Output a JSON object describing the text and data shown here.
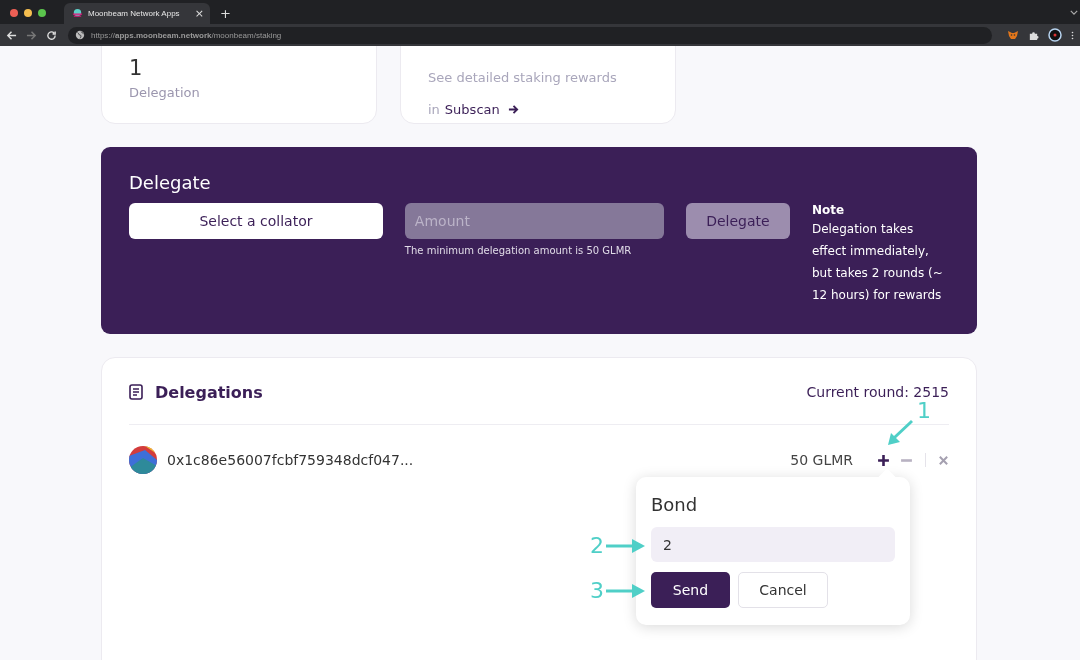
{
  "browser": {
    "tab_title": "Moonbeam Network Apps",
    "tab_close": "×",
    "new_tab": "+",
    "url": "https://**apps.moonbeam.network**/moonbeam/staking",
    "forward_disabled": true
  },
  "summary_cards": [
    {
      "kind": "stat",
      "value": "1",
      "label": "Delegation"
    },
    {
      "kind": "link",
      "text": "See detailed staking rewards",
      "prefix": "in",
      "link": "Subscan"
    }
  ],
  "delegate_panel": {
    "title": "Delegate",
    "collator_button": "Select a collator",
    "amount": {
      "placeholder": "Amount"
    },
    "hint": "The minimum delegation amount is 50 GLMR",
    "delegate_button": "Delegate",
    "delegate_disabled": true,
    "note_title": "Note",
    "note": "Delegation takes effect immediately, but takes 2 rounds (~ 12 hours) for rewards"
  },
  "delegations": {
    "title": "Delegations",
    "current_round": "Current round: 2515",
    "rows": [
      {
        "address": "0x1c86e56007fcbf759348dcf047...",
        "amount": "50 GLMR"
      }
    ]
  },
  "bond_popover": {
    "title": "Bond",
    "value": "2",
    "send_button": "Send",
    "cancel_button": "Cancel"
  },
  "annotations": [
    {
      "kind": "down-left",
      "label": "1"
    },
    {
      "kind": "right",
      "label": "2"
    },
    {
      "kind": "right",
      "label": "3"
    }
  ]
}
